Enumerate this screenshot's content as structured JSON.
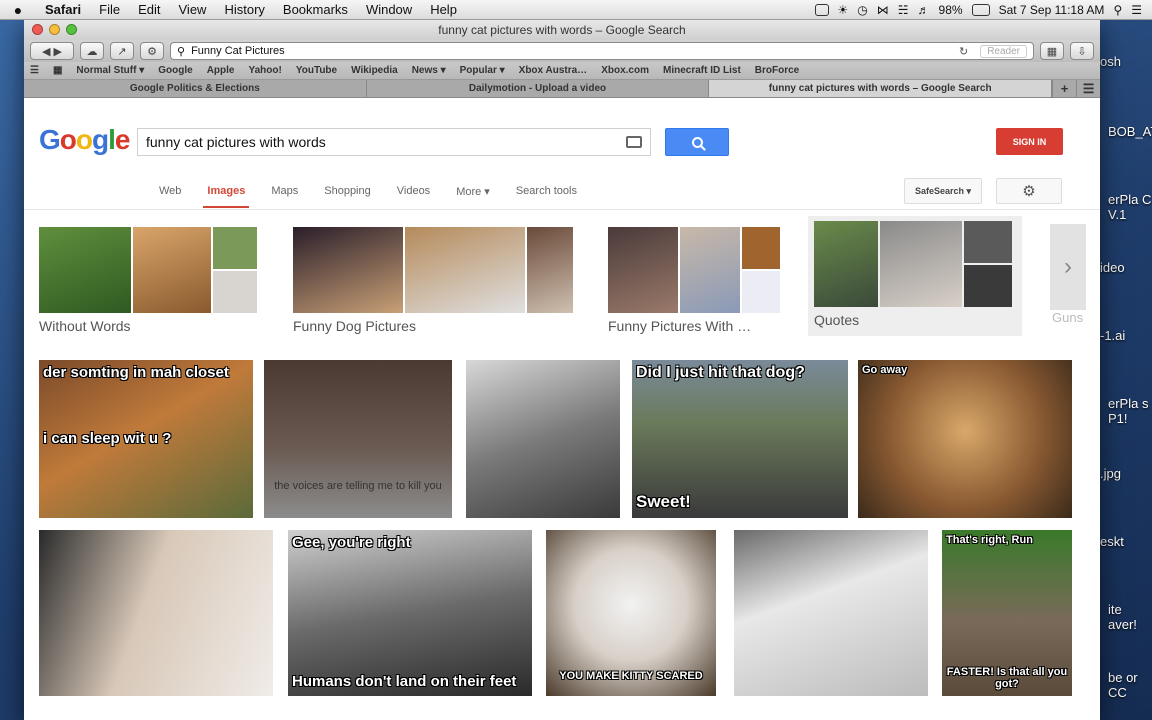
{
  "menubar": {
    "apple": "",
    "app": "Safari",
    "menus": [
      "File",
      "Edit",
      "View",
      "History",
      "Bookmarks",
      "Window",
      "Help"
    ],
    "battery": "98%",
    "clock": "Sat 7 Sep  11:18 AM"
  },
  "window": {
    "title": "funny cat pictures with words – Google Search",
    "address": "Funny Cat Pictures",
    "reader": "Reader"
  },
  "bookmarks": [
    "Normal Stuff ▾",
    "Google",
    "Apple",
    "Yahoo!",
    "YouTube",
    "Wikipedia",
    "News ▾",
    "Popular ▾",
    "Xbox Austra…",
    "Xbox.com",
    "Minecraft ID List",
    "BroForce"
  ],
  "tabs": [
    "Google Politics & Elections",
    "Dailymotion - Upload a video",
    "funny cat pictures with words – Google Search"
  ],
  "google": {
    "query": "funny cat pictures with words",
    "signin": "SIGN IN",
    "nav": [
      "Web",
      "Images",
      "Maps",
      "Shopping",
      "Videos",
      "More ▾",
      "Search tools"
    ],
    "safesearch": "SafeSearch ▾",
    "related": [
      "Without Words",
      "Funny Dog Pictures",
      "Funny Pictures With …",
      "Quotes",
      "Guns"
    ]
  },
  "captions": {
    "c1_top": "der somting in mah closet",
    "c1_mid": "i can sleep wit u ?",
    "c2_bot": "the voices are telling me to kill you",
    "c4_top": "Did I just hit that dog?",
    "c4_bot": "Sweet!",
    "c5_top": "Go away",
    "c7_top": "Gee, you're right",
    "c7_bot": "Humans don't land on their feet",
    "c8_bot": "YOU MAKE KITTY SCARED",
    "c10_top": "That's right, Run",
    "c10_bot": "FASTER! Is that all you got?"
  },
  "desktop_labels": [
    "osh",
    "BOB_ATTY",
    "erPla C V.1",
    "ideo",
    "-1.ai",
    "erPla s P1!",
    ".jpg",
    "eskt",
    "ite aver!",
    "be or CC"
  ],
  "colors": {
    "google_blue": "#4a8af4",
    "signin_red": "#d73d32",
    "active_tab_red": "#d14836"
  }
}
